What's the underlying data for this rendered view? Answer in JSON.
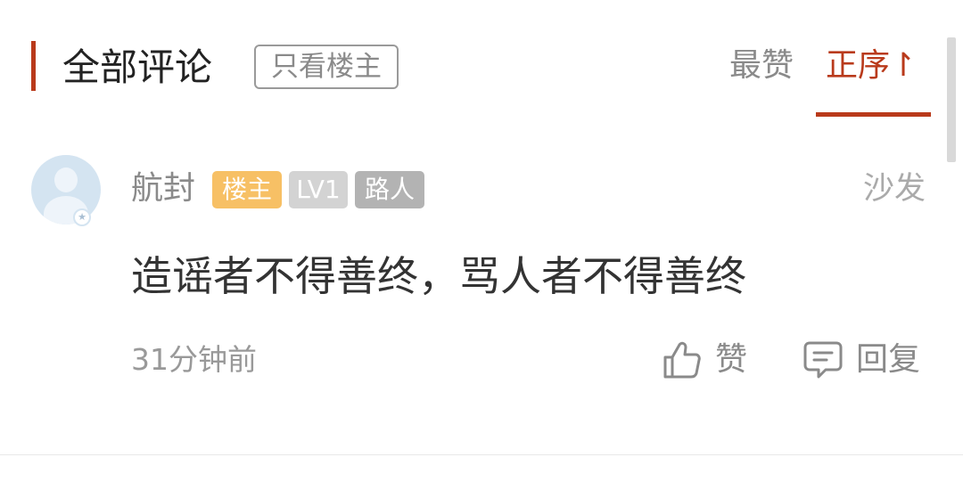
{
  "header": {
    "title": "全部评论",
    "op_only_label": "只看楼主",
    "sort_tabs": [
      {
        "label": "最赞",
        "active": false
      },
      {
        "label": "正序↾",
        "active": true
      }
    ]
  },
  "colors": {
    "accent": "#b93a1b",
    "op_badge": "#f7c065",
    "level_badge": "#d3d3d3",
    "role_badge": "#b3b3b3",
    "muted_text": "#8a8a8a"
  },
  "comment": {
    "avatar_icon": "default-user-avatar",
    "username": "航封",
    "badges": {
      "op": "楼主",
      "level": "LV1",
      "role": "路人"
    },
    "floor": "沙发",
    "content": "造谣者不得善终，骂人者不得善终",
    "time": "31分钟前",
    "actions": {
      "like_label": "赞",
      "like_icon": "thumbs-up-icon",
      "reply_label": "回复",
      "reply_icon": "comment-bubble-icon"
    }
  }
}
